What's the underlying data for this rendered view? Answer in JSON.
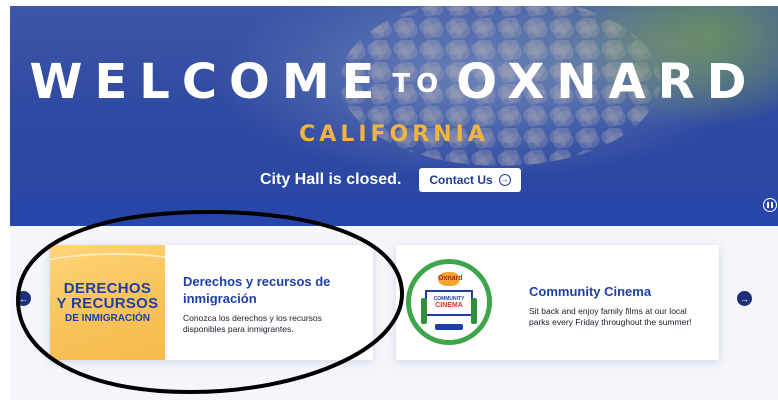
{
  "hero": {
    "welcome": "WELCOME",
    "to": "TO",
    "city": "OXNARD",
    "state": "CALIFORNIA",
    "notice": "City Hall is closed.",
    "contact_label": "Contact Us",
    "contact_icon": "arrow-circle-right-icon",
    "pause_icon": "pause-circle-icon"
  },
  "carousel": {
    "prev_icon": "arrow-circle-left-icon",
    "next_icon": "arrow-circle-right-icon",
    "cards": [
      {
        "image_line1": "DERECHOS",
        "image_line2": "Y RECURSOS",
        "image_line3": "DE INMIGRACIÓN",
        "title": "Derechos y recursos de inmigración",
        "description": "Conozca los derechos y los recursos disponibles para inmigrantes."
      },
      {
        "logo_badge": "Oxnard",
        "logo_line1": "COMMUNITY",
        "logo_line2": "CINEMA",
        "title": "Community Cinema",
        "description": "Sit back and enjoy family films at our local parks every Friday throughout the summer!"
      }
    ]
  },
  "colors": {
    "hero_blue": "#2f4aa2",
    "accent_gold": "#f2b441",
    "link_blue": "#1e3fa8",
    "cinema_green": "#3da64a"
  }
}
